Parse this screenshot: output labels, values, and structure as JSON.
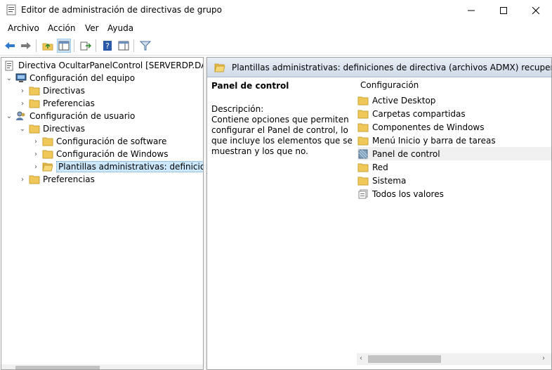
{
  "window": {
    "title": "Editor de administración de directivas de grupo"
  },
  "menu": [
    "Archivo",
    "Acción",
    "Ver",
    "Ayuda"
  ],
  "tree": {
    "root": "Directiva OcultarPanelControl [SERVERDP.DARI.LO",
    "computer_config": "Configuración del equipo",
    "cc_directivas": "Directivas",
    "cc_preferencias": "Preferencias",
    "user_config": "Configuración de usuario",
    "uc_directivas": "Directivas",
    "software_config": "Configuración de software",
    "windows_config": "Configuración de Windows",
    "admin_templates": "Plantillas administrativas: definiciones",
    "uc_preferencias": "Preferencias"
  },
  "right": {
    "header": "Plantillas administrativas: definiciones de directiva (archivos ADMX) recuperadas del eq",
    "selected_title": "Panel de control",
    "description_label": "Descripción:",
    "description_text": "Contiene opciones que permiten configurar el Panel de control, lo que incluye los elementos que se muestran y los que no.",
    "list_header": "Configuración",
    "items": [
      {
        "label": "Active Desktop",
        "icon": "folder-icon"
      },
      {
        "label": "Carpetas compartidas",
        "icon": "folder-icon"
      },
      {
        "label": "Componentes de Windows",
        "icon": "folder-icon"
      },
      {
        "label": "Menú Inicio y barra de tareas",
        "icon": "folder-icon"
      },
      {
        "label": "Panel de control",
        "icon": "control-panel-icon"
      },
      {
        "label": "Red",
        "icon": "folder-icon"
      },
      {
        "label": "Sistema",
        "icon": "folder-icon"
      },
      {
        "label": "Todos los valores",
        "icon": "all-settings-icon"
      }
    ]
  },
  "colors": {
    "folder": "#f0c85a",
    "selection": "#cce8ff",
    "header_gradient_bottom": "#cfdbe9"
  }
}
